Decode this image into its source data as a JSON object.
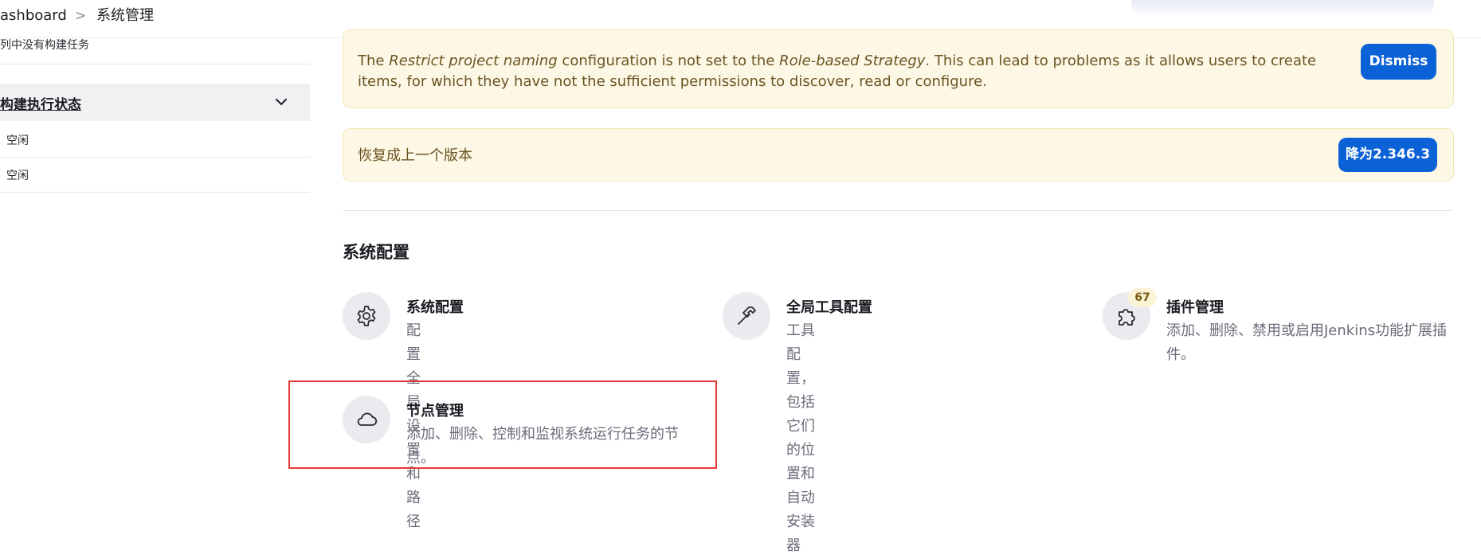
{
  "breadcrumb": {
    "dashboard": "ashboard",
    "separator": ">",
    "current": "系统管理"
  },
  "sidebar": {
    "queue_empty": "列中没有构建任务",
    "executor_header": "构建执行状态",
    "executors": [
      "空闲",
      "空闲"
    ]
  },
  "notices": {
    "naming": {
      "p1": "The ",
      "em1": "Restrict project naming",
      "p2": " configuration is not set to the ",
      "em2": "Role-based Strategy",
      "p3": ". This can lead to problems as it allows users to create items, for which they have not the sufficient permissions to discover, read or configure.",
      "button": "Dismiss"
    },
    "downgrade": {
      "text": "恢复成上一个版本",
      "button": "降为2.346.3"
    }
  },
  "section": {
    "title": "系统配置",
    "items": [
      {
        "title": "系统配置",
        "desc": "配置全局设置和路径",
        "icon": "gear-icon"
      },
      {
        "title": "全局工具配置",
        "desc": "工具配置，包括它们的位置和自动安装器",
        "icon": "hammer-icon"
      },
      {
        "title": "插件管理",
        "desc": "添加、删除、禁用或启用Jenkins功能扩展插件。",
        "icon": "puzzle-icon",
        "badge": "67"
      },
      {
        "title": "节点管理",
        "desc": "添加、删除、控制和监视系统运行任务的节点。",
        "icon": "cloud-icon"
      }
    ]
  },
  "colors": {
    "notice_bg": "#fdf8e5",
    "button": "#0b62d6",
    "highlight": "#e53935"
  }
}
